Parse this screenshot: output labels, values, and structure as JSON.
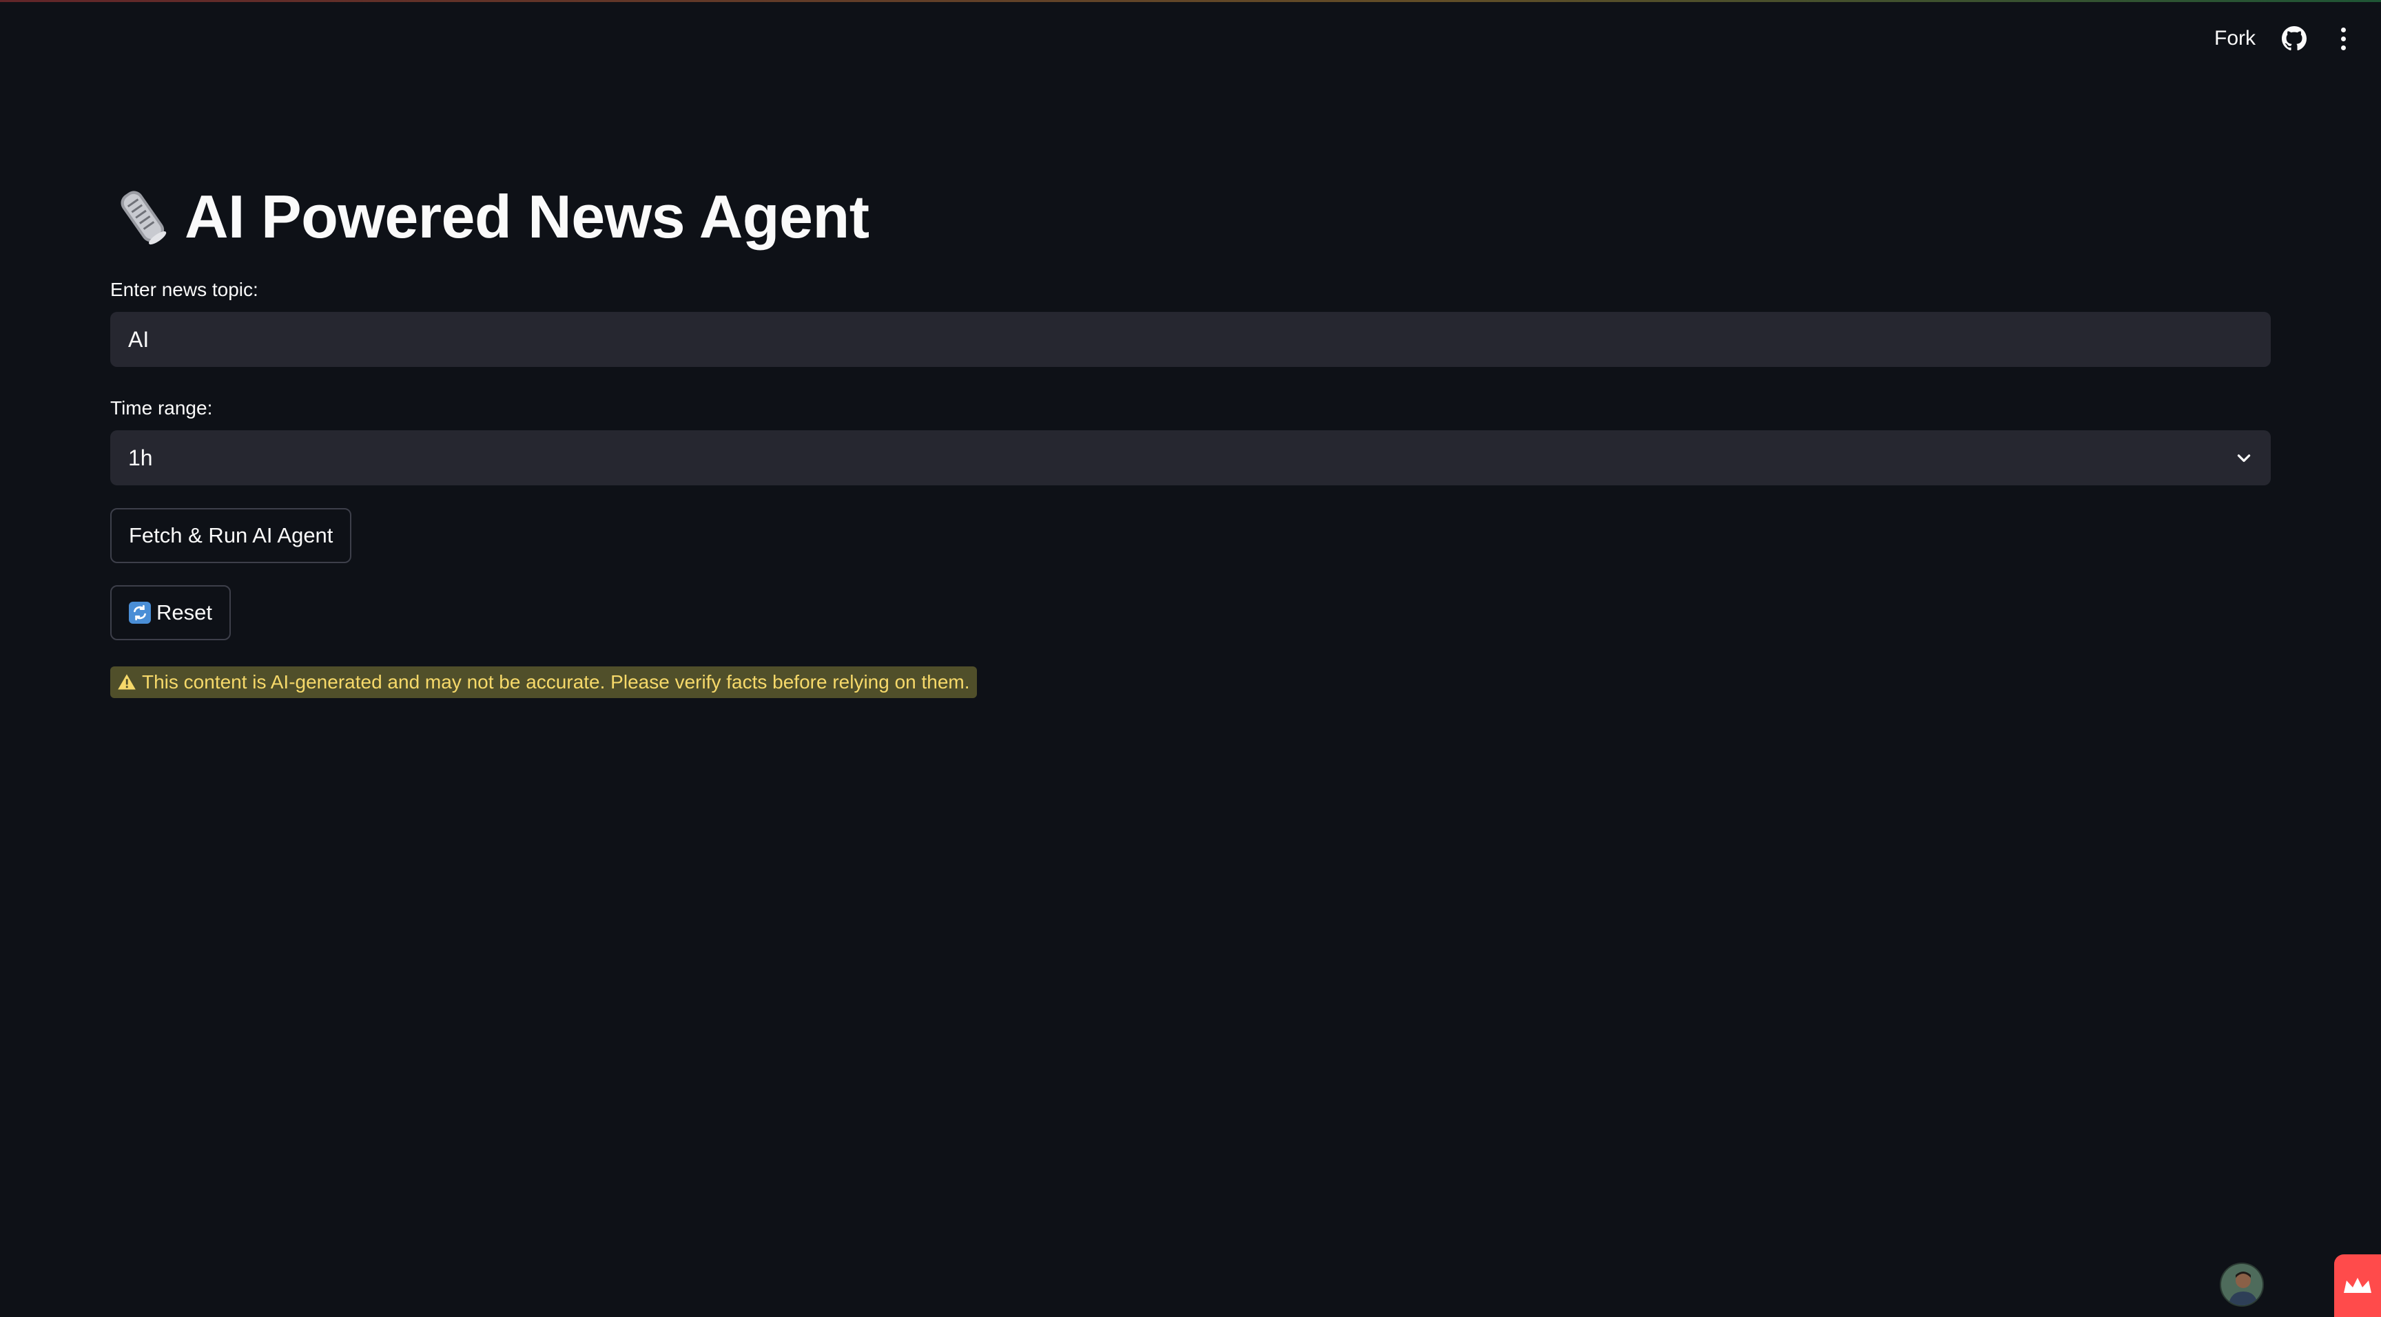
{
  "header": {
    "fork_label": "Fork",
    "github_icon": "github-icon",
    "menu_icon": "kebab-menu-icon"
  },
  "main": {
    "title_icon": "newspaper-roll-icon",
    "title": "AI Powered News Agent",
    "topic_label": "Enter news topic:",
    "topic_value": "AI",
    "time_label": "Time range:",
    "time_value": "1h",
    "fetch_button": "Fetch & Run AI Agent",
    "reset_icon": "counterclockwise-arrows-icon",
    "reset_button": "Reset",
    "warning_icon": "warning-icon",
    "warning_text": "This content is AI-generated and may not be accurate. Please verify facts before relying on them."
  },
  "footer": {
    "avatar": "user-avatar",
    "badge_icon": "crown-icon"
  },
  "colors": {
    "background": "#0e1117",
    "input_bg": "#262730",
    "warning_bg": "#504f2a",
    "warning_text": "#f6d96a",
    "accent": "#ff4b4b"
  }
}
